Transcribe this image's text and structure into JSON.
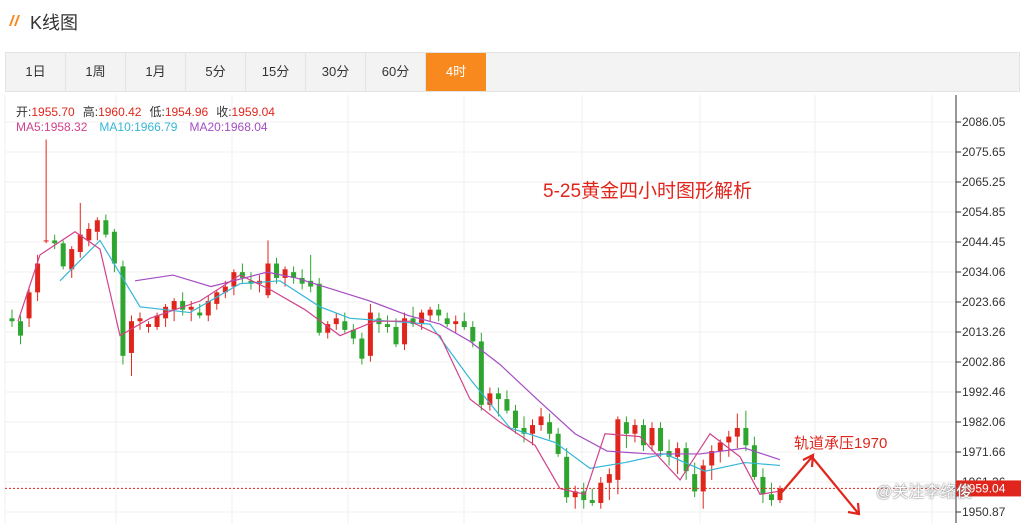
{
  "page": {
    "title": "K线图",
    "accent": "#f7891e"
  },
  "tabs": [
    {
      "label": "1日",
      "active": false
    },
    {
      "label": "1周",
      "active": false
    },
    {
      "label": "1月",
      "active": false
    },
    {
      "label": "5分",
      "active": false
    },
    {
      "label": "15分",
      "active": false
    },
    {
      "label": "30分",
      "active": false
    },
    {
      "label": "60分",
      "active": false
    },
    {
      "label": "4时",
      "active": true
    }
  ],
  "ohlc": {
    "open_label": "开:",
    "open": "1955.70",
    "high_label": "高:",
    "high": "1960.42",
    "low_label": "低:",
    "low": "1954.96",
    "close_label": "收:",
    "close": "1959.04"
  },
  "ma": {
    "ma5_label": "MA5:",
    "ma5": "1958.32",
    "ma10_label": "MA10:",
    "ma10": "1966.79",
    "ma20_label": "MA20:",
    "ma20": "1968.04"
  },
  "annotations": {
    "title": "5-25黄金四小时图形解析",
    "note": "轨道承压1970",
    "watermark": "@关注李络俊"
  },
  "chart_data": {
    "type": "candlestick",
    "ylim": [
      1946,
      2096
    ],
    "yticks": [
      "2086.05",
      "2075.65",
      "2065.25",
      "2054.85",
      "2044.45",
      "2034.06",
      "2023.66",
      "2013.26",
      "2002.86",
      "1992.46",
      "1982.06",
      "1971.66",
      "1961.26",
      "1950.87"
    ],
    "colors": {
      "up": "#e0261c",
      "down": "#2ea52e",
      "ma5": "#d0428a",
      "ma10": "#35b6d6",
      "ma20": "#a54cc4"
    },
    "candles": [
      [
        2018,
        2021,
        2015,
        2017
      ],
      [
        2017,
        2019,
        2009,
        2012
      ],
      [
        2018,
        2029,
        2015,
        2027
      ],
      [
        2027,
        2040,
        2024,
        2037
      ],
      [
        2045,
        2080,
        2044,
        2045
      ],
      [
        2045,
        2047,
        2042,
        2044
      ],
      [
        2044,
        2045,
        2035,
        2036
      ],
      [
        2035,
        2043,
        2032,
        2042
      ],
      [
        2041,
        2058,
        2039,
        2047
      ],
      [
        2045,
        2051,
        2043,
        2049
      ],
      [
        2048,
        2053,
        2045,
        2052
      ],
      [
        2052,
        2054,
        2046,
        2047
      ],
      [
        2048,
        2049,
        2034,
        2037
      ],
      [
        2036,
        2038,
        2002,
        2005
      ],
      [
        2006,
        2019,
        1998,
        2017
      ],
      [
        2017,
        2020,
        2014,
        2018
      ],
      [
        2015,
        2017,
        2013,
        2016
      ],
      [
        2015,
        2020,
        2014,
        2019
      ],
      [
        2018,
        2023,
        2015,
        2022
      ],
      [
        2021,
        2025,
        2017,
        2024
      ],
      [
        2024,
        2027,
        2019,
        2021
      ],
      [
        2021,
        2024,
        2017,
        2022
      ],
      [
        2020,
        2023,
        2018,
        2019
      ],
      [
        2019,
        2026,
        2017,
        2024
      ],
      [
        2023,
        2028,
        2021,
        2027
      ],
      [
        2027,
        2031,
        2025,
        2029
      ],
      [
        2029,
        2035,
        2026,
        2034
      ],
      [
        2034,
        2037,
        2030,
        2032
      ],
      [
        2031,
        2034,
        2028,
        2030
      ],
      [
        2030,
        2033,
        2027,
        2031
      ],
      [
        2026,
        2045,
        2025,
        2037
      ],
      [
        2037,
        2039,
        2030,
        2032
      ],
      [
        2032,
        2036,
        2029,
        2035
      ],
      [
        2034,
        2036,
        2030,
        2032
      ],
      [
        2032,
        2035,
        2028,
        2030
      ],
      [
        2031,
        2040,
        2027,
        2029
      ],
      [
        2030,
        2032,
        2012,
        2013
      ],
      [
        2013,
        2017,
        2011,
        2016
      ],
      [
        2016,
        2020,
        2014,
        2018
      ],
      [
        2017,
        2020,
        2013,
        2014
      ],
      [
        2014,
        2016,
        2009,
        2011
      ],
      [
        2011,
        2013,
        2002,
        2004
      ],
      [
        2005,
        2023,
        2003,
        2020
      ],
      [
        2018,
        2020,
        2013,
        2016
      ],
      [
        2016,
        2019,
        2013,
        2015
      ],
      [
        2015,
        2018,
        2008,
        2009
      ],
      [
        2009,
        2020,
        2007,
        2018
      ],
      [
        2018,
        2022,
        2015,
        2016
      ],
      [
        2016,
        2021,
        2014,
        2020
      ],
      [
        2019,
        2022,
        2017,
        2021
      ],
      [
        2021,
        2023,
        2017,
        2019
      ],
      [
        2018,
        2020,
        2015,
        2016
      ],
      [
        2016,
        2019,
        2013,
        2017
      ],
      [
        2017,
        2020,
        2014,
        2015
      ],
      [
        2015,
        2017,
        2008,
        2010
      ],
      [
        2010,
        2013,
        1986,
        1988
      ],
      [
        1988,
        1994,
        1986,
        1992
      ],
      [
        1992,
        1994,
        1984,
        1990
      ],
      [
        1990,
        1993,
        1985,
        1986
      ],
      [
        1986,
        1988,
        1978,
        1980
      ],
      [
        1980,
        1984,
        1975,
        1978
      ],
      [
        1978,
        1983,
        1974,
        1981
      ],
      [
        1981,
        1987,
        1979,
        1984
      ],
      [
        1982,
        1985,
        1976,
        1978
      ],
      [
        1978,
        1980,
        1970,
        1971
      ],
      [
        1970,
        1973,
        1954,
        1956
      ],
      [
        1956,
        1960,
        1952,
        1958
      ],
      [
        1958,
        1961,
        1952,
        1955
      ],
      [
        1955,
        1959,
        1953,
        1954
      ],
      [
        1954,
        1963,
        1952,
        1961
      ],
      [
        1961,
        1966,
        1955,
        1964
      ],
      [
        1962,
        1984,
        1957,
        1983
      ],
      [
        1982,
        1984,
        1973,
        1978
      ],
      [
        1978,
        1983,
        1975,
        1981
      ],
      [
        1981,
        1983,
        1972,
        1974
      ],
      [
        1974,
        1982,
        1972,
        1980
      ],
      [
        1980,
        1982,
        1970,
        1972
      ],
      [
        1972,
        1976,
        1967,
        1970
      ],
      [
        1970,
        1975,
        1964,
        1973
      ],
      [
        1973,
        1975,
        1962,
        1965
      ],
      [
        1964,
        1968,
        1956,
        1958
      ],
      [
        1958,
        1969,
        1952,
        1967
      ],
      [
        1967,
        1974,
        1962,
        1972
      ],
      [
        1972,
        1976,
        1968,
        1975
      ],
      [
        1975,
        1979,
        1970,
        1977
      ],
      [
        1977,
        1985,
        1973,
        1980
      ],
      [
        1980,
        1986,
        1972,
        1974
      ],
      [
        1974,
        1977,
        1962,
        1963
      ],
      [
        1963,
        1966,
        1954,
        1957
      ],
      [
        1957,
        1961,
        1953,
        1955
      ],
      [
        1955,
        1960,
        1954,
        1959
      ]
    ],
    "ma20": [
      [
        135,
        2031
      ],
      [
        173,
        2033
      ],
      [
        211,
        2029
      ],
      [
        267,
        2034
      ],
      [
        296,
        2032
      ],
      [
        333,
        2028
      ],
      [
        370,
        2024
      ],
      [
        408,
        2019
      ],
      [
        440,
        2016
      ],
      [
        470,
        2010
      ],
      [
        500,
        2002
      ],
      [
        540,
        1989
      ],
      [
        575,
        1978
      ],
      [
        607,
        1972
      ],
      [
        650,
        1971
      ],
      [
        700,
        1971
      ],
      [
        745,
        1973
      ],
      [
        780,
        1969
      ]
    ],
    "ma10": [
      [
        60,
        2031
      ],
      [
        100,
        2045
      ],
      [
        140,
        2022
      ],
      [
        190,
        2020
      ],
      [
        240,
        2030
      ],
      [
        280,
        2031
      ],
      [
        320,
        2022
      ],
      [
        350,
        2018
      ],
      [
        390,
        2017
      ],
      [
        430,
        2016
      ],
      [
        470,
        1997
      ],
      [
        510,
        1980
      ],
      [
        555,
        1975
      ],
      [
        590,
        1966
      ],
      [
        625,
        1968
      ],
      [
        665,
        1971
      ],
      [
        705,
        1965
      ],
      [
        745,
        1968
      ],
      [
        780,
        1967
      ]
    ],
    "ma5": [
      [
        18,
        2017
      ],
      [
        40,
        2040
      ],
      [
        75,
        2048
      ],
      [
        100,
        2042
      ],
      [
        120,
        2012
      ],
      [
        150,
        2018
      ],
      [
        200,
        2024
      ],
      [
        240,
        2033
      ],
      [
        270,
        2028
      ],
      [
        305,
        2021
      ],
      [
        340,
        2012
      ],
      [
        375,
        2017
      ],
      [
        410,
        2017
      ],
      [
        440,
        2012
      ],
      [
        470,
        1990
      ],
      [
        500,
        1982
      ],
      [
        535,
        1974
      ],
      [
        560,
        1959
      ],
      [
        585,
        1957
      ],
      [
        605,
        1978
      ],
      [
        640,
        1977
      ],
      [
        680,
        1962
      ],
      [
        710,
        1978
      ],
      [
        740,
        1970
      ],
      [
        760,
        1957
      ],
      [
        778,
        1958
      ]
    ],
    "current_price": 1959.04
  }
}
